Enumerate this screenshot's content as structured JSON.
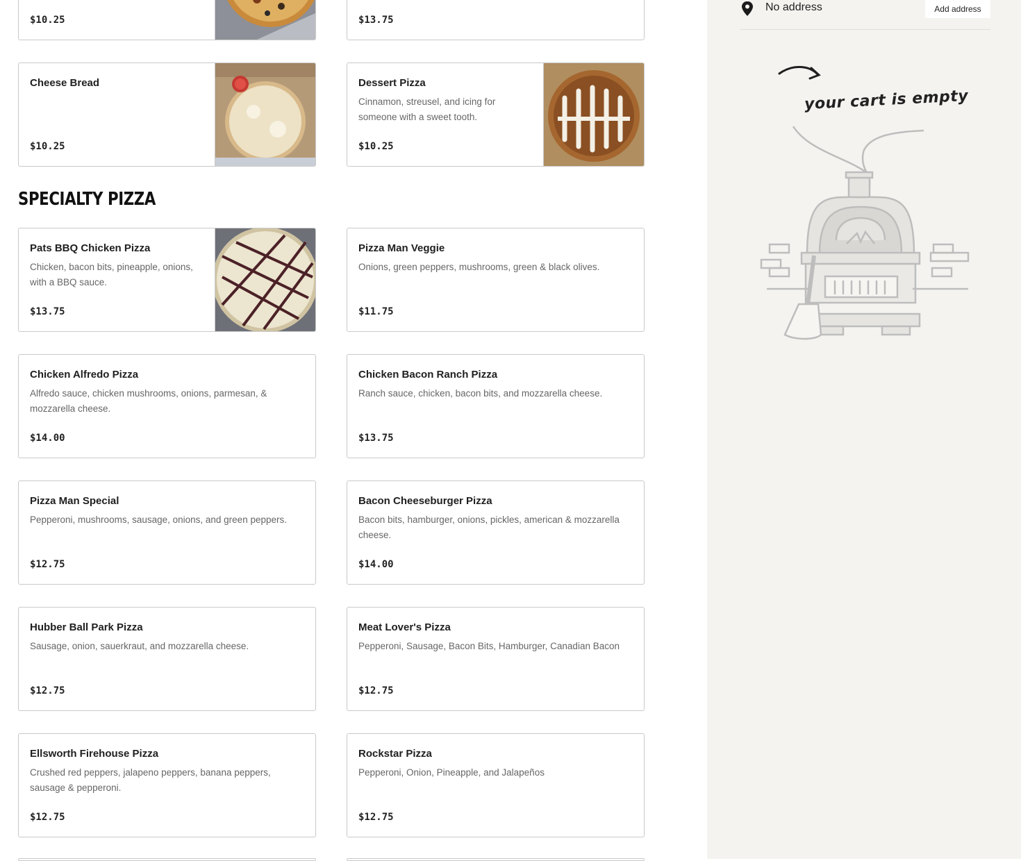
{
  "section_title": "SPECIALTY PIZZA",
  "top_items": [
    {
      "price": "$10.25"
    },
    {
      "price": "$13.75"
    }
  ],
  "items": [
    {
      "name": "Cheese Bread",
      "description": "",
      "price": "$10.25"
    },
    {
      "name": "Dessert Pizza",
      "description": "Cinnamon, streusel, and icing for someone with a sweet tooth.",
      "price": "$10.25"
    },
    {
      "name": "Pats BBQ Chicken Pizza",
      "description": "Chicken, bacon bits, pineapple, onions, with a BBQ sauce.",
      "price": "$13.75"
    },
    {
      "name": "Pizza Man Veggie",
      "description": "Onions, green peppers, mushrooms, green & black olives.",
      "price": "$11.75"
    },
    {
      "name": "Chicken Alfredo Pizza",
      "description": "Alfredo sauce, chicken mushrooms, onions, parmesan, & mozzarella cheese.",
      "price": "$14.00"
    },
    {
      "name": "Chicken Bacon Ranch Pizza",
      "description": "Ranch sauce, chicken, bacon bits, and mozzarella cheese.",
      "price": "$13.75"
    },
    {
      "name": "Pizza Man Special",
      "description": "Pepperoni, mushrooms, sausage, onions, and green peppers.",
      "price": "$12.75"
    },
    {
      "name": "Bacon Cheeseburger Pizza",
      "description": "Bacon bits, hamburger, onions, pickles, american & mozzarella cheese.",
      "price": "$14.00"
    },
    {
      "name": "Hubber Ball Park Pizza",
      "description": "Sausage, onion, sauerkraut, and mozzarella cheese.",
      "price": "$12.75"
    },
    {
      "name": "Meat Lover's Pizza",
      "description": "Pepperoni, Sausage, Bacon Bits, Hamburger, Canadian Bacon",
      "price": "$12.75"
    },
    {
      "name": "Ellsworth Firehouse Pizza",
      "description": "Crushed red peppers, jalapeno peppers, banana peppers, sausage & pepperoni.",
      "price": "$12.75"
    },
    {
      "name": "Rockstar Pizza",
      "description": "Pepperoni, Onion, Pineapple, and Jalapeños",
      "price": "$12.75"
    }
  ],
  "cart": {
    "address_label": "No address",
    "add_address_label": "Add address",
    "empty_message": "your cart is empty"
  },
  "icons": {
    "address": "map-pin-icon",
    "illustration": "pizza-oven-illustration"
  },
  "colors": {
    "sidebar_bg": "#f4f3f0",
    "card_border": "#c9c9c9",
    "text": "#202020",
    "muted_text": "#666666"
  }
}
